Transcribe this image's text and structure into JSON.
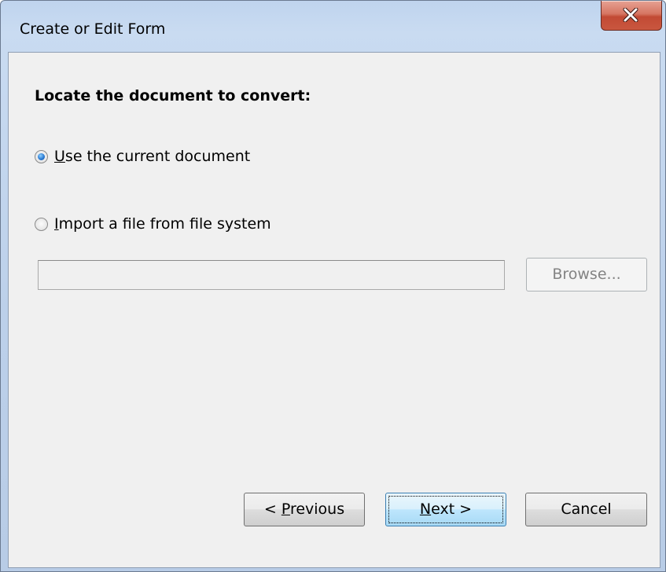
{
  "window": {
    "title": "Create or Edit Form"
  },
  "main": {
    "heading": "Locate the document to convert:",
    "options": [
      {
        "accel": "U",
        "rest": "se the current document",
        "checked": true
      },
      {
        "accel": "I",
        "rest": "mport a file from file system",
        "checked": false
      }
    ],
    "file_path": {
      "value": "",
      "placeholder": ""
    },
    "browse_label": "Browse..."
  },
  "footer": {
    "previous": {
      "prefix": "< ",
      "accel": "P",
      "rest": "revious"
    },
    "next": {
      "prefix": "",
      "accel": "N",
      "rest": "ext >"
    },
    "cancel_label": "Cancel"
  },
  "colors": {
    "titlebar": "#c9dbf1",
    "client_bg": "#f0f0f0",
    "close_button": "#c24a34",
    "default_button": "#bee6fd",
    "radio_dot": "#2b7bd3"
  },
  "icons": {
    "close": "close-x-icon"
  }
}
